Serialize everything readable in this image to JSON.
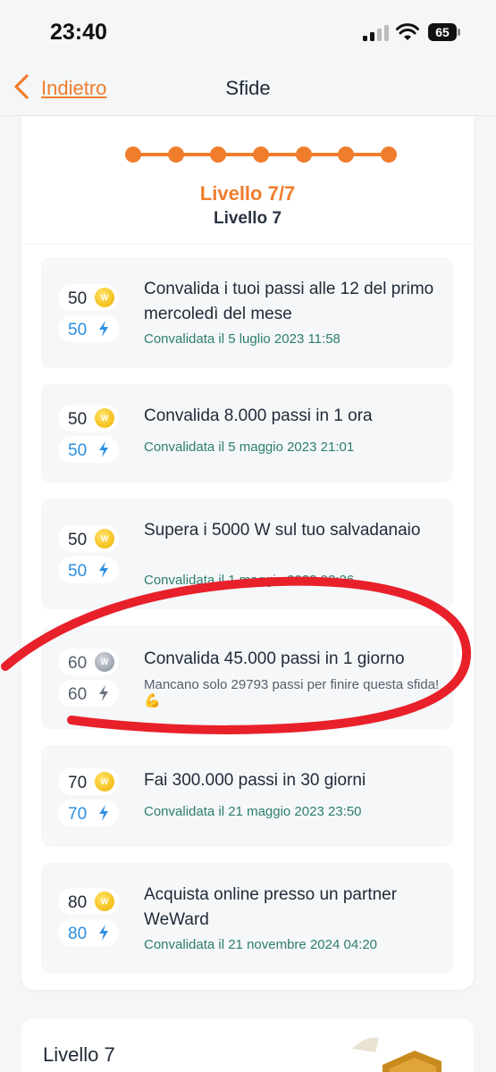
{
  "status_bar": {
    "time": "23:40",
    "battery": "65"
  },
  "nav": {
    "back_label": "Indietro",
    "title": "Sfide"
  },
  "level": {
    "title": "Livello 7/7",
    "subtitle": "Livello 7",
    "total_levels": 7,
    "completed_levels": 7,
    "accent_color": "#f07d2c"
  },
  "challenges": [
    {
      "coins": "50",
      "bolts": "50",
      "title": "Convalida i tuoi passi alle 12 del primo mercoledì del mese",
      "status": "Convalidata il 5 luglio 2023 11:58",
      "completed": true
    },
    {
      "coins": "50",
      "bolts": "50",
      "title": "Convalida 8.000 passi in 1 ora",
      "status": "Convalidata il 5 maggio 2023 21:01",
      "completed": true
    },
    {
      "coins": "50",
      "bolts": "50",
      "title": "Supera i 5000 W sul tuo salvadanaio",
      "status": "Convalidata il 1 maggio 2023 02:26",
      "completed": true
    },
    {
      "coins": "60",
      "bolts": "60",
      "title": "Convalida 45.000 passi in 1 giorno",
      "status": "Mancano solo 29793 passi per finire questa sfida! 💪",
      "completed": false
    },
    {
      "coins": "70",
      "bolts": "70",
      "title": "Fai 300.000 passi in 30 giorni",
      "status": "Convalidata il 21 maggio 2023 23:50",
      "completed": true
    },
    {
      "coins": "80",
      "bolts": "80",
      "title": "Acquista online presso un partner WeWard",
      "status": "Convalidata il 21 novembre 2024 04:20",
      "completed": true
    }
  ],
  "bottom": {
    "title": "Livello 7"
  },
  "icons": {
    "back": "chevron-left-icon",
    "coin": "coin-icon",
    "bolt": "bolt-icon",
    "badge": "level-badge-icon"
  },
  "colors": {
    "completed_text": "#2e7d6f",
    "bolt": "#2b8fe0",
    "annotation": "#e8202a"
  }
}
